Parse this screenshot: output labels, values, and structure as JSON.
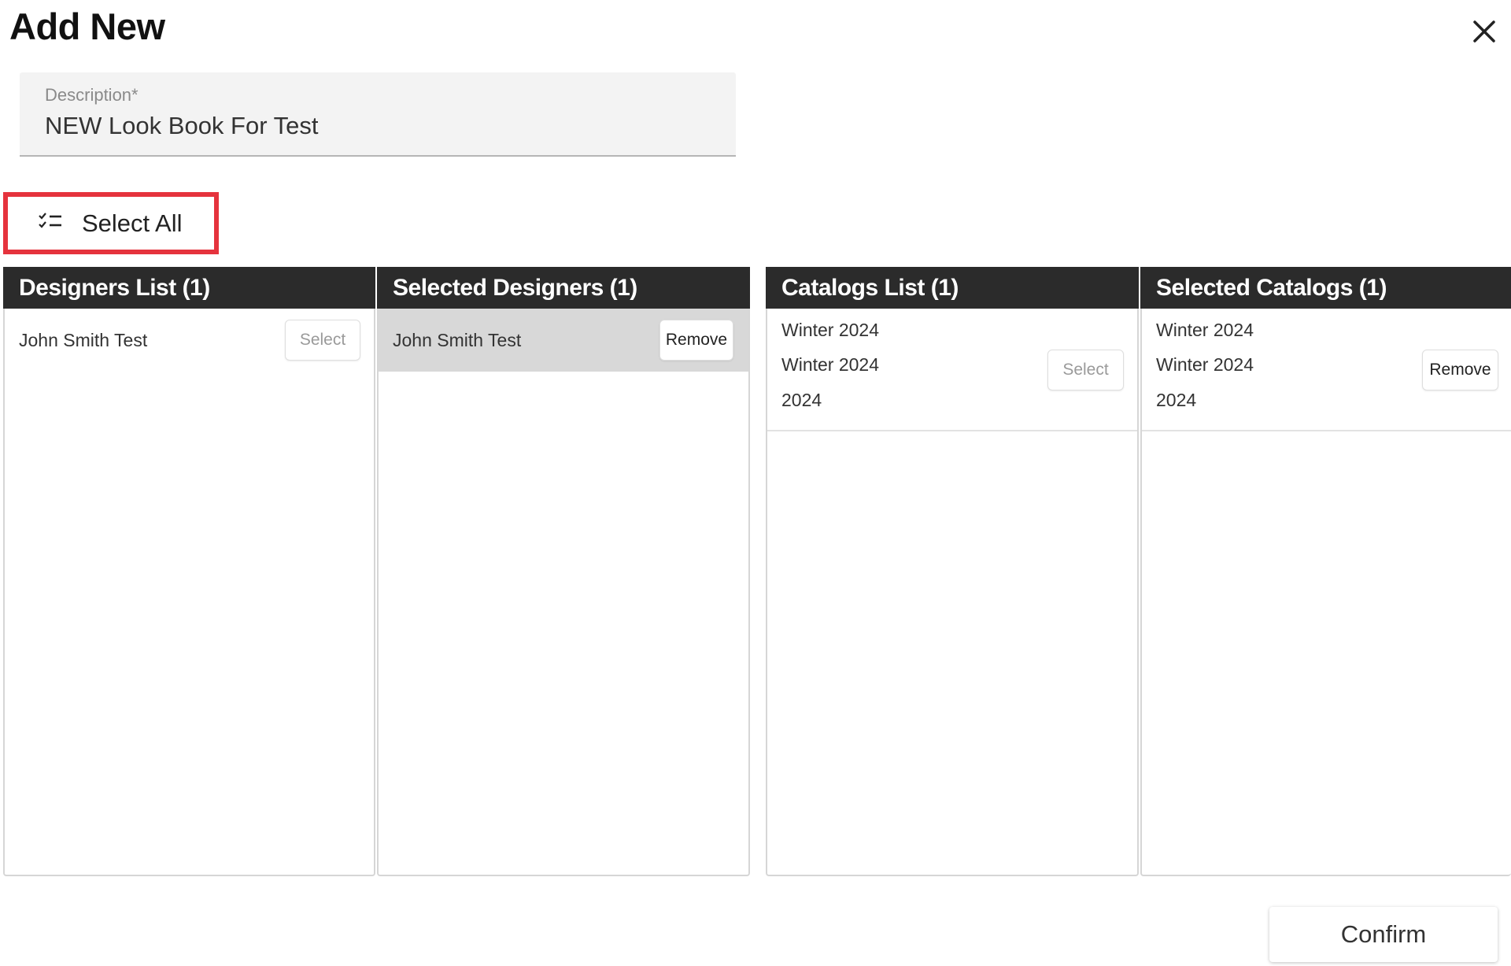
{
  "dialog": {
    "title": "Add New",
    "close_icon": "close-icon"
  },
  "description": {
    "label": "Description*",
    "value": "NEW Look Book For Test"
  },
  "select_all": {
    "icon": "checklist-icon",
    "label": "Select All",
    "highlight_color": "#e5333d"
  },
  "panels": {
    "designers_list": {
      "header": "Designers List (1)",
      "items": [
        {
          "name": "John Smith Test",
          "button": "Select"
        }
      ]
    },
    "selected_designers": {
      "header": "Selected Designers (1)",
      "items": [
        {
          "name": "John Smith Test",
          "button": "Remove"
        }
      ]
    },
    "catalogs_list": {
      "header": "Catalogs List (1)",
      "items": [
        {
          "line1": "Winter 2024",
          "line2": "Winter 2024",
          "line3": "2024",
          "button": "Select"
        }
      ]
    },
    "selected_catalogs": {
      "header": "Selected Catalogs (1)",
      "items": [
        {
          "line1": "Winter 2024",
          "line2": "Winter 2024",
          "line3": "2024",
          "button": "Remove"
        }
      ]
    }
  },
  "footer": {
    "confirm_label": "Confirm"
  },
  "colors": {
    "header_bg": "#2b2b2b",
    "selected_row_bg": "#d8d8d8",
    "field_bg": "#f3f3f3"
  }
}
